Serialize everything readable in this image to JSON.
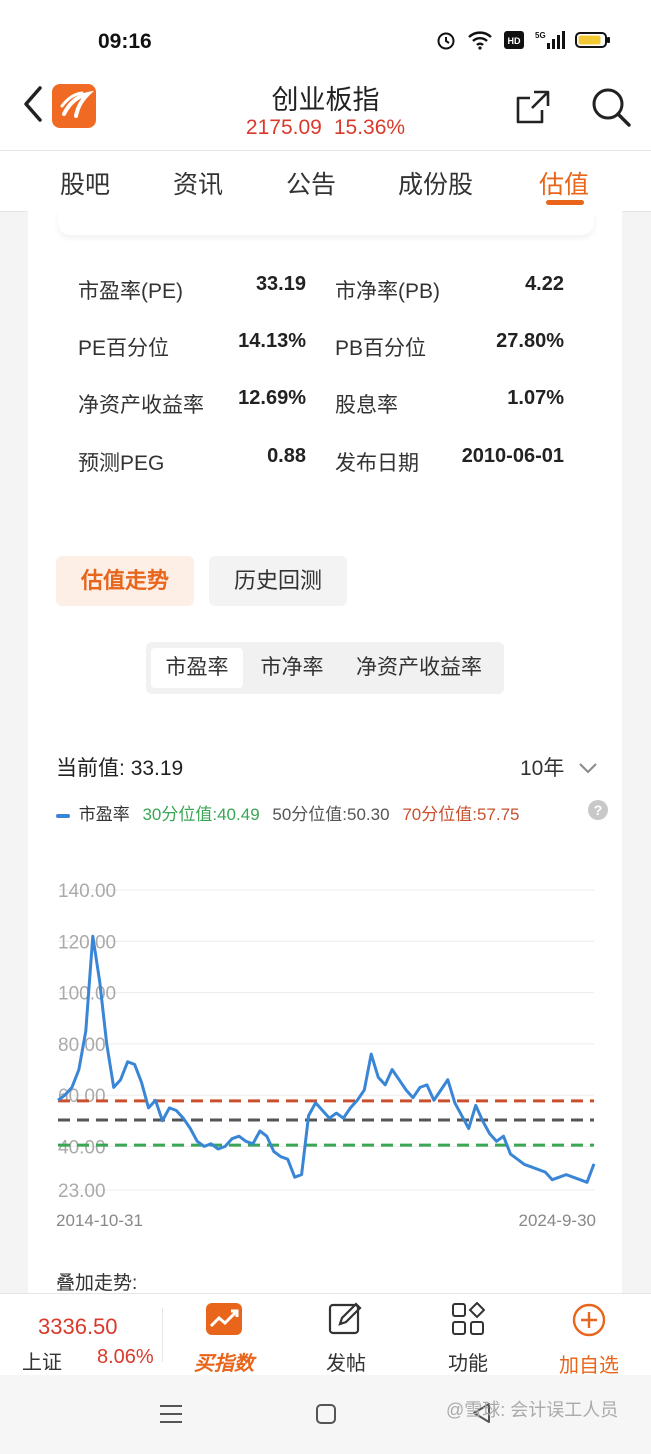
{
  "status_bar": {
    "time": "09:16"
  },
  "header": {
    "title": "创业板指",
    "price": "2175.09",
    "change": "15.36%"
  },
  "tabs": [
    {
      "label": "股吧"
    },
    {
      "label": "资讯"
    },
    {
      "label": "公告"
    },
    {
      "label": "成份股"
    },
    {
      "label": "估值",
      "active": true
    }
  ],
  "metrics": [
    {
      "label": "市盈率(PE)",
      "value": "33.19"
    },
    {
      "label": "市净率(PB)",
      "value": "4.22"
    },
    {
      "label": "PE百分位",
      "value": "14.13%"
    },
    {
      "label": "PB百分位",
      "value": "27.80%"
    },
    {
      "label": "净资产收益率",
      "value": "12.69%"
    },
    {
      "label": "股息率",
      "value": "1.07%"
    },
    {
      "label": "预测PEG",
      "value": "0.88"
    },
    {
      "label": "发布日期",
      "value": "2010-06-01"
    }
  ],
  "buttons": {
    "trend": "估值走势",
    "backtest": "历史回测"
  },
  "segments": [
    "市盈率",
    "市净率",
    "净资产收益率"
  ],
  "current": {
    "label": "当前值:",
    "value": "33.19"
  },
  "period": "10年",
  "legend": {
    "series": "市盈率",
    "p30": "30分位值:40.49",
    "p50": "50分位值:50.30",
    "p70": "70分位值:57.75",
    "help": "?"
  },
  "colors": {
    "accent": "#e8651b",
    "up": "#d93a2b",
    "line": "#3a86d6",
    "p30": "#3aa655",
    "p50": "#555555",
    "p70": "#c9502e"
  },
  "chart_data": {
    "type": "line",
    "ylim": [
      23,
      140
    ],
    "y_ticks": [
      "140.00",
      "120.00",
      "100.00",
      "80.00",
      "60.00",
      "40.00",
      "23.00"
    ],
    "x_labels": [
      "2014-10-31",
      "2024-9-30"
    ],
    "reference_lines": [
      {
        "name": "30分位值",
        "value": 40.49
      },
      {
        "name": "50分位值",
        "value": 50.3
      },
      {
        "name": "70分位值",
        "value": 57.75
      }
    ],
    "series": [
      {
        "name": "市盈率",
        "values": [
          58,
          60,
          63,
          70,
          85,
          122,
          104,
          80,
          63,
          66,
          73,
          72,
          65,
          55,
          58,
          50,
          55,
          54,
          51,
          47,
          42,
          40,
          41,
          39,
          40,
          43,
          44,
          42,
          41,
          46,
          44,
          38,
          36,
          35,
          28,
          29,
          52,
          57,
          54,
          51,
          53,
          51,
          55,
          58,
          62,
          76,
          67,
          64,
          70,
          66,
          62,
          59,
          63,
          64,
          58,
          62,
          66,
          57,
          52,
          47,
          56,
          50,
          45,
          42,
          44,
          37,
          35,
          33,
          32,
          31,
          30,
          27,
          28,
          29,
          28,
          27,
          26,
          33.19
        ]
      }
    ]
  },
  "overlay_label": "叠加走势:",
  "bottom_nav": {
    "index_value": "3336.50",
    "index_name": "上证",
    "index_change": "8.06%",
    "items": [
      {
        "label": "买指数"
      },
      {
        "label": "发帖"
      },
      {
        "label": "功能"
      },
      {
        "label": "加自选"
      }
    ]
  },
  "watermark": "@雪球: 会计误工人员"
}
